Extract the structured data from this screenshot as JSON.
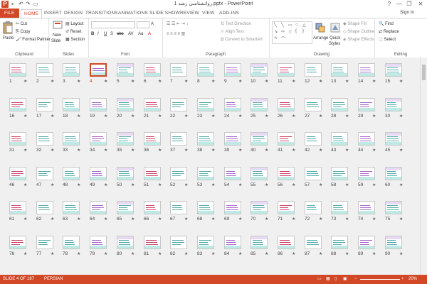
{
  "titlebar": {
    "title": "روانشناسی رشد 1.pptx - PowerPoint",
    "logo": "P",
    "quick_access": [
      "save-icon",
      "undo-icon",
      "redo-icon",
      "start-icon"
    ],
    "window_controls": [
      "?",
      "—",
      "❐",
      "✕"
    ]
  },
  "tabs": [
    "FILE",
    "HOME",
    "INSERT",
    "DESIGN",
    "TRANSITIONS",
    "ANIMATIONS",
    "SLIDE SHOW",
    "REVIEW",
    "VIEW",
    "ADD-INS"
  ],
  "active_tab": "HOME",
  "signin": "Sign in",
  "ribbon": {
    "clipboard": {
      "label": "Clipboard",
      "paste": "Paste",
      "cut": "Cut",
      "copy": "Copy",
      "format_painter": "Format Painter"
    },
    "slides": {
      "label": "Slides",
      "new_slide": "New",
      "new_slide2": "Slide",
      "layout": "Layout",
      "reset": "Reset",
      "section": "Section"
    },
    "font": {
      "label": "Font",
      "buttons": [
        "B",
        "I",
        "U",
        "S",
        "abc",
        "AV",
        "Aa",
        "A"
      ]
    },
    "paragraph": {
      "label": "Paragraph",
      "text_direction": "Text Direction",
      "align_text": "Align Text",
      "smartart": "Convert to SmartArt"
    },
    "drawing": {
      "label": "Drawing",
      "arrange": "Arrange",
      "quick_styles": "Quick",
      "quick_styles2": "Styles",
      "shape_fill": "Shape Fill",
      "shape_outline": "Shape Outline",
      "shape_effects": "Shape Effects"
    },
    "editing": {
      "label": "Editing",
      "find": "Find",
      "replace": "Replace",
      "select": "Select"
    }
  },
  "slides": {
    "total": 187,
    "selected": 4,
    "visible_numbers": [
      1,
      2,
      3,
      4,
      5,
      6,
      7,
      8,
      9,
      10,
      11,
      12,
      13,
      14,
      15,
      16,
      17,
      18,
      19,
      20,
      21,
      22,
      23,
      24,
      25,
      26,
      27,
      28,
      29,
      30,
      31,
      32,
      33,
      34,
      35,
      36,
      37,
      38,
      39,
      40,
      41,
      42,
      43,
      44,
      45,
      46,
      47,
      48,
      49,
      50,
      51,
      52,
      53,
      54,
      55,
      56,
      57,
      58,
      59,
      60,
      61,
      62,
      63,
      64,
      65,
      66,
      67,
      68,
      69,
      70,
      71,
      72,
      73,
      74,
      75,
      76,
      77,
      78,
      79,
      80,
      81,
      82,
      83,
      84,
      85,
      86,
      87,
      88,
      89,
      90
    ],
    "star": "★"
  },
  "status": {
    "slide_info": "SLIDE 4 OF 187",
    "language": "PERSIAN",
    "zoom": "20%"
  },
  "colors": {
    "accent": "#d24726",
    "selected_border": "#d24726"
  }
}
